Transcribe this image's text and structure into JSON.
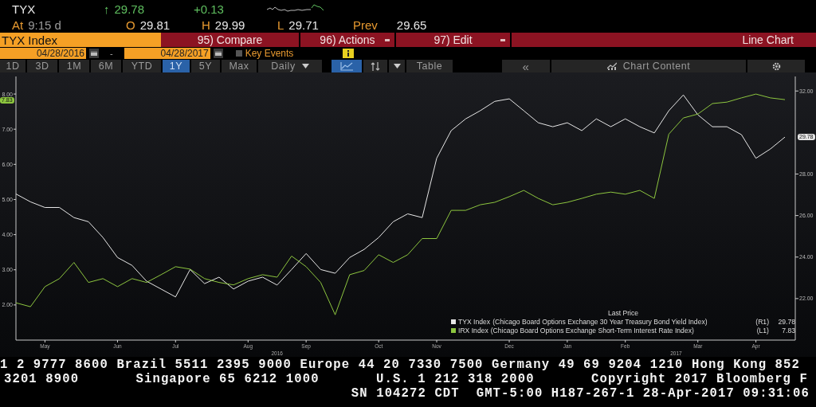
{
  "quote": {
    "ticker": "TYX",
    "arrow": "↑",
    "last": "29.78",
    "change": "+0.13",
    "time_label": "At",
    "time": "9:15 d",
    "open_label": "O",
    "open": "29.81",
    "high_label": "H",
    "high": "29.99",
    "low_label": "L",
    "low": "29.71",
    "prev_label": "Prev",
    "prev": "29.65"
  },
  "menu_bar": {
    "security": "TYX Index",
    "actions": [
      {
        "label": "95) Compare",
        "dropdown": false
      },
      {
        "label": "96) Actions",
        "dropdown": true
      },
      {
        "label": "97) Edit",
        "dropdown": true
      }
    ],
    "view": "Line Chart"
  },
  "date_range": {
    "start": "04/28/2016",
    "separator": "-",
    "end": "04/28/2017",
    "key_events": {
      "label": "Key Events",
      "checked": false
    }
  },
  "toolbar": {
    "periods": [
      {
        "label": "1D",
        "selected": false
      },
      {
        "label": "3D",
        "selected": false
      },
      {
        "label": "1M",
        "selected": false
      },
      {
        "label": "6M",
        "selected": false
      },
      {
        "label": "YTD",
        "selected": false
      },
      {
        "label": "1Y",
        "selected": true
      },
      {
        "label": "5Y",
        "selected": false
      },
      {
        "label": "Max",
        "selected": false
      }
    ],
    "frequency": "Daily",
    "tools": [
      {
        "kind": "line-chart",
        "selected": true
      },
      {
        "kind": "arrows",
        "selected": false
      },
      {
        "kind": "caret",
        "selected": false
      }
    ],
    "table": "Table",
    "collapse": "«",
    "chart_content": "Chart Content"
  },
  "chart": {
    "left_badge": "7.83",
    "right_badge": "29.78",
    "year_labels": [
      "2016",
      "2017"
    ],
    "legend": {
      "title": "Last Price",
      "items": [
        {
          "description": "(Chicago Board Options Exchange 30 Year Treasury Bond Yield Index)",
          "axis": "(R1)",
          "value": "29.78"
        },
        {
          "description": "(Chicago Board Options Exchange Short-Term Interest Rate Index)",
          "axis": "(L1)",
          "value": "7.83"
        }
      ]
    },
    "chart_data": {
      "type": "line",
      "categories": [
        null,
        null,
        "May",
        null,
        null,
        null,
        null,
        "Jun",
        null,
        null,
        null,
        "Jul",
        null,
        null,
        null,
        null,
        "Aug",
        null,
        null,
        null,
        "Sep",
        null,
        null,
        null,
        null,
        "Oct",
        null,
        null,
        null,
        "Nov",
        null,
        null,
        null,
        null,
        "Dec",
        null,
        null,
        null,
        "Jan",
        null,
        null,
        null,
        "Feb",
        null,
        null,
        null,
        null,
        "Mar",
        null,
        null,
        null,
        "Apr",
        null,
        null
      ],
      "ylim": [
        1,
        8.5
      ],
      "yticks": [
        {
          "value": 2,
          "label": "2.00"
        },
        {
          "value": 3,
          "label": "3.00"
        },
        {
          "value": 4,
          "label": "4.00"
        },
        {
          "value": 5,
          "label": "5.00"
        },
        {
          "value": 6,
          "label": "6.00"
        },
        {
          "value": 7,
          "label": "7.00"
        },
        {
          "value": 8,
          "label": "8.00"
        }
      ],
      "y2lim": [
        20,
        32.7
      ],
      "y2ticks": [
        {
          "value": 22,
          "label": "22.00"
        },
        {
          "value": 24,
          "label": "24.00"
        },
        {
          "value": 26,
          "label": "26.00"
        },
        {
          "value": 28,
          "label": "28.00"
        },
        {
          "value": 32,
          "label": "32.00"
        }
      ],
      "series": [
        {
          "name": "TYX Index",
          "color": "#e6e6e6",
          "axis": "y2",
          "values": [
            27.04,
            26.66,
            26.39,
            26.39,
            25.9,
            25.7,
            24.94,
            23.98,
            23.6,
            22.84,
            22.46,
            22.08,
            23.4,
            22.72,
            23.03,
            22.46,
            22.84,
            23.03,
            22.65,
            23.4,
            24.17,
            23.4,
            23.22,
            23.98,
            24.37,
            24.94,
            25.7,
            26.08,
            25.9,
            28.76,
            30.09,
            30.66,
            31.05,
            31.5,
            31.62,
            31.05,
            30.47,
            30.28,
            30.47,
            30.09,
            30.66,
            30.28,
            30.66,
            30.28,
            29.98,
            31.05,
            31.81,
            30.85,
            30.28,
            30.28,
            29.9,
            28.76,
            29.21,
            29.78
          ]
        },
        {
          "name": "IRX Index",
          "color": "#8dc63f",
          "values": [
            2.06,
            1.95,
            2.52,
            2.75,
            3.21,
            2.64,
            2.75,
            2.52,
            2.75,
            2.64,
            2.86,
            3.09,
            3.02,
            2.75,
            2.64,
            2.57,
            2.75,
            2.86,
            2.79,
            3.39,
            3.09,
            2.64,
            1.72,
            2.86,
            2.98,
            3.43,
            3.21,
            3.43,
            3.89,
            3.89,
            4.69,
            4.69,
            4.85,
            4.92,
            5.08,
            5.26,
            5.03,
            4.85,
            4.92,
            5.03,
            5.15,
            5.21,
            5.15,
            5.26,
            5.03,
            6.86,
            7.32,
            7.43,
            7.73,
            7.77,
            7.89,
            8.0,
            7.89,
            7.84
          ]
        }
      ]
    }
  },
  "footer": {
    "lines": [
      [
        "1 2 9777 8600 Brazil 5511 2395 9000 Europe 44 20 7330 7500 Germany 49 69 9204 1210 Hong Kong 852"
      ],
      [
        "3201 8900",
        "Singapore 65 6212 1000",
        "U.S. 1 212 318 2000",
        "Copyright 2017 Bloomberg F"
      ],
      [
        "SN 104272 CDT  GMT-5:00 H187-267-1 28-Apr-2017 09:31:06"
      ]
    ]
  }
}
